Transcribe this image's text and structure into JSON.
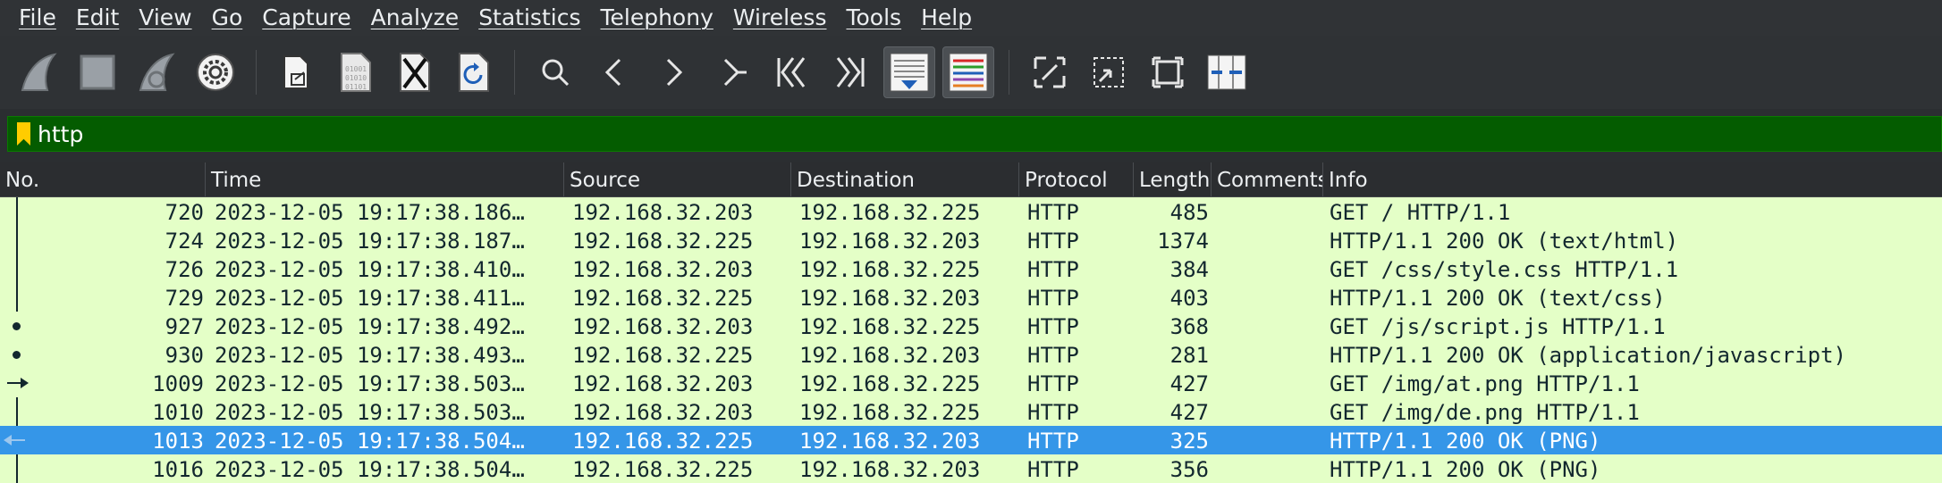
{
  "menu": [
    "File",
    "Edit",
    "View",
    "Go",
    "Capture",
    "Analyze",
    "Statistics",
    "Telephony",
    "Wireless",
    "Tools",
    "Help"
  ],
  "toolbar": {
    "start_capture": "shark-fin-start-icon",
    "stop_capture": "stop-square-icon",
    "restart_capture": "shark-fin-restart-icon",
    "capture_options": "gear-icon",
    "open_file": "open-file-icon",
    "save_file": "save-binary-file-icon",
    "close_file": "close-file-icon",
    "reload_file": "reload-file-icon",
    "find_packet": "search-icon",
    "go_back": "chevron-left-icon",
    "go_forward": "chevron-right-icon",
    "go_to_packet": "go-to-packet-icon",
    "go_first": "first-packet-icon",
    "go_last": "last-packet-icon",
    "autoscroll": "autoscroll-icon",
    "colorize": "colorize-icon",
    "zoom_in": "zoom-in-icon",
    "zoom_out": "zoom-out-icon",
    "normal_size": "normal-size-icon",
    "resize_columns": "resize-columns-icon"
  },
  "filter": {
    "value": "http",
    "bookmark_icon": "bookmark-icon",
    "bg_color": "#045c00"
  },
  "columns": [
    "No.",
    "Time",
    "Source",
    "Destination",
    "Protocol",
    "Length",
    "Comments",
    "Info"
  ],
  "rows": [
    {
      "no": "720",
      "time": "2023-12-05 19:17:38.186…",
      "src": "192.168.32.203",
      "dst": "192.168.32.225",
      "proto": "HTTP",
      "len": "485",
      "comments": "",
      "info": "GET / HTTP/1.1",
      "rel": "line"
    },
    {
      "no": "724",
      "time": "2023-12-05 19:17:38.187…",
      "src": "192.168.32.225",
      "dst": "192.168.32.203",
      "proto": "HTTP",
      "len": "1374",
      "comments": "",
      "info": "HTTP/1.1 200 OK  (text/html)",
      "rel": "line"
    },
    {
      "no": "726",
      "time": "2023-12-05 19:17:38.410…",
      "src": "192.168.32.203",
      "dst": "192.168.32.225",
      "proto": "HTTP",
      "len": "384",
      "comments": "",
      "info": "GET /css/style.css HTTP/1.1",
      "rel": "line"
    },
    {
      "no": "729",
      "time": "2023-12-05 19:17:38.411…",
      "src": "192.168.32.225",
      "dst": "192.168.32.203",
      "proto": "HTTP",
      "len": "403",
      "comments": "",
      "info": "HTTP/1.1 200 OK  (text/css)",
      "rel": "line"
    },
    {
      "no": "927",
      "time": "2023-12-05 19:17:38.492…",
      "src": "192.168.32.203",
      "dst": "192.168.32.225",
      "proto": "HTTP",
      "len": "368",
      "comments": "",
      "info": "GET /js/script.js HTTP/1.1",
      "rel": "dot"
    },
    {
      "no": "930",
      "time": "2023-12-05 19:17:38.493…",
      "src": "192.168.32.225",
      "dst": "192.168.32.203",
      "proto": "HTTP",
      "len": "281",
      "comments": "",
      "info": "HTTP/1.1 200 OK  (application/javascript)",
      "rel": "dot"
    },
    {
      "no": "1009",
      "time": "2023-12-05 19:17:38.503…",
      "src": "192.168.32.203",
      "dst": "192.168.32.225",
      "proto": "HTTP",
      "len": "427",
      "comments": "",
      "info": "GET /img/at.png HTTP/1.1",
      "rel": "arrow"
    },
    {
      "no": "1010",
      "time": "2023-12-05 19:17:38.503…",
      "src": "192.168.32.203",
      "dst": "192.168.32.225",
      "proto": "HTTP",
      "len": "427",
      "comments": "",
      "info": "GET /img/de.png HTTP/1.1",
      "rel": "line"
    },
    {
      "no": "1013",
      "time": "2023-12-05 19:17:38.504…",
      "src": "192.168.32.225",
      "dst": "192.168.32.203",
      "proto": "HTTP",
      "len": "325",
      "comments": "",
      "info": "HTTP/1.1 200 OK  (PNG)",
      "rel": "back",
      "selected": true
    },
    {
      "no": "1016",
      "time": "2023-12-05 19:17:38.504…",
      "src": "192.168.32.225",
      "dst": "192.168.32.203",
      "proto": "HTTP",
      "len": "356",
      "comments": "",
      "info": "HTTP/1.1 200 OK  (PNG)",
      "rel": "line"
    }
  ],
  "colors": {
    "row_bg": "#e4ffc7",
    "selected_bg": "#3596e8",
    "text": "#12272e"
  }
}
